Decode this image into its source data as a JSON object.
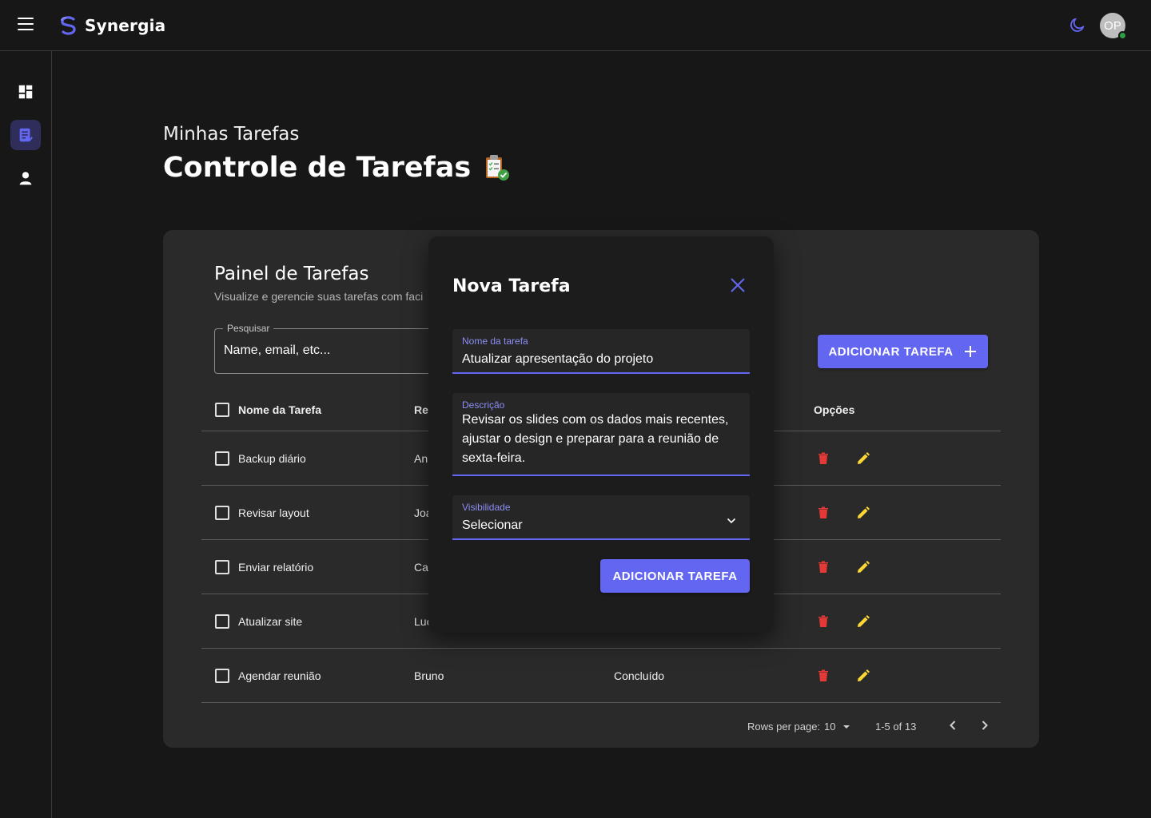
{
  "app": {
    "name": "Synergia"
  },
  "user": {
    "initials": "OP"
  },
  "header": {
    "subtitle": "Minhas Tarefas",
    "title": "Controle de Tarefas",
    "title_icon": "clipboard-check-icon"
  },
  "sidebar": {
    "items": [
      {
        "icon": "dashboard-icon",
        "active": false
      },
      {
        "icon": "tasks-icon",
        "active": true
      },
      {
        "icon": "person-icon",
        "active": false
      }
    ]
  },
  "panel": {
    "title": "Painel de Tarefas",
    "subtitle": "Visualize e gerencie suas tarefas com faci",
    "search": {
      "label": "Pesquisar",
      "placeholder": "Name, email, etc..."
    },
    "add_button": "ADICIONAR TAREFA"
  },
  "table": {
    "headers": {
      "name": "Nome da Tarefa",
      "resp": "Res",
      "status": "",
      "options": "Opções"
    },
    "rows": [
      {
        "name": "Backup diário",
        "resp": "An",
        "status": ""
      },
      {
        "name": "Revisar layout",
        "resp": "Joa",
        "status": ""
      },
      {
        "name": "Enviar relatório",
        "resp": "Ca",
        "status": ""
      },
      {
        "name": "Atualizar site",
        "resp": "Luc",
        "status": ""
      },
      {
        "name": "Agendar reunião",
        "resp": "Bruno",
        "status": "Concluído"
      }
    ]
  },
  "pagination": {
    "rows_per_page_label": "Rows per page:",
    "rows_per_page": "10",
    "range": "1-5 of 13"
  },
  "dialog": {
    "title": "Nova Tarefa",
    "name_label": "Nome da tarefa",
    "name_value": "Atualizar apresentação do projeto",
    "desc_label": "Descrição",
    "desc_value": "Revisar os slides com os dados mais recentes, ajustar o design e preparar para a reunião de sexta-feira.",
    "vis_label": "Visibilidade",
    "vis_value": "Selecionar",
    "submit": "ADICIONAR TAREFA"
  },
  "colors": {
    "accent": "#6366f1",
    "delete": "#e53935",
    "edit": "#fdd835",
    "online": "#2ea043"
  }
}
